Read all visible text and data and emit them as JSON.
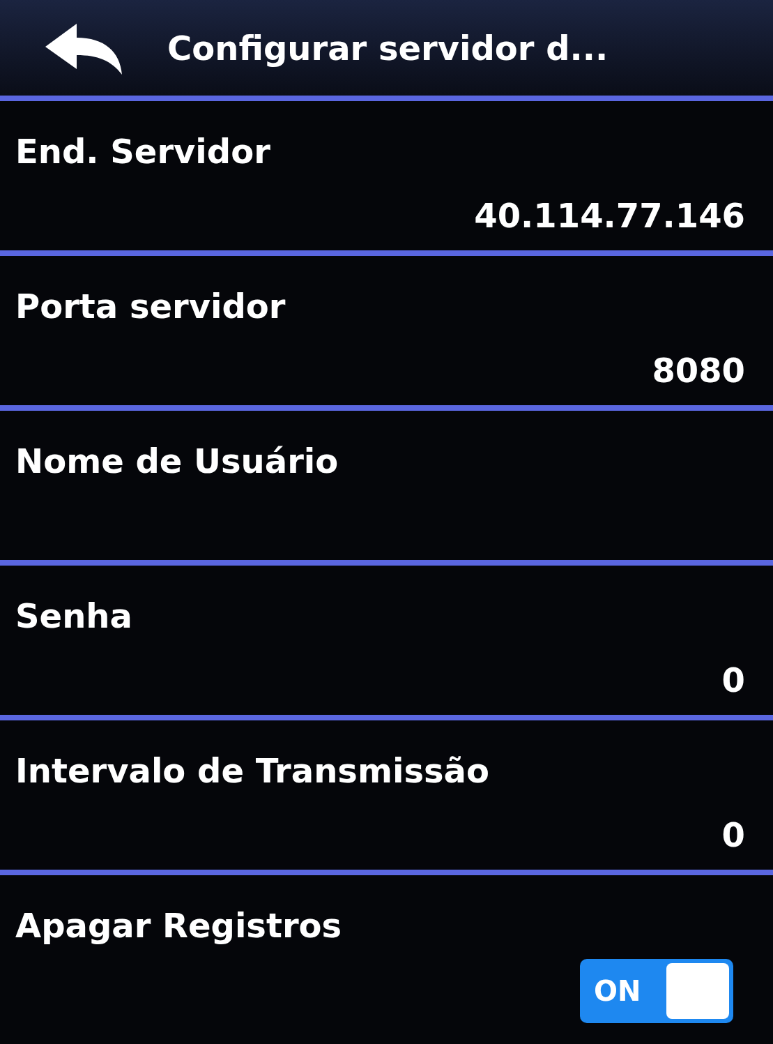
{
  "header": {
    "title": "Configurar servidor d..."
  },
  "settings": [
    {
      "kind": "value",
      "label": "End. Servidor",
      "value": "40.114.77.146"
    },
    {
      "kind": "value",
      "label": "Porta servidor",
      "value": "8080"
    },
    {
      "kind": "value",
      "label": "Nome de Usuário"
    },
    {
      "kind": "value",
      "label": "Senha",
      "value": "0"
    },
    {
      "kind": "value",
      "label": "Intervalo de Transmissão",
      "value": "0"
    },
    {
      "kind": "toggle",
      "label": "Apagar Registros",
      "on": true,
      "toggle_label": "ON"
    }
  ]
}
